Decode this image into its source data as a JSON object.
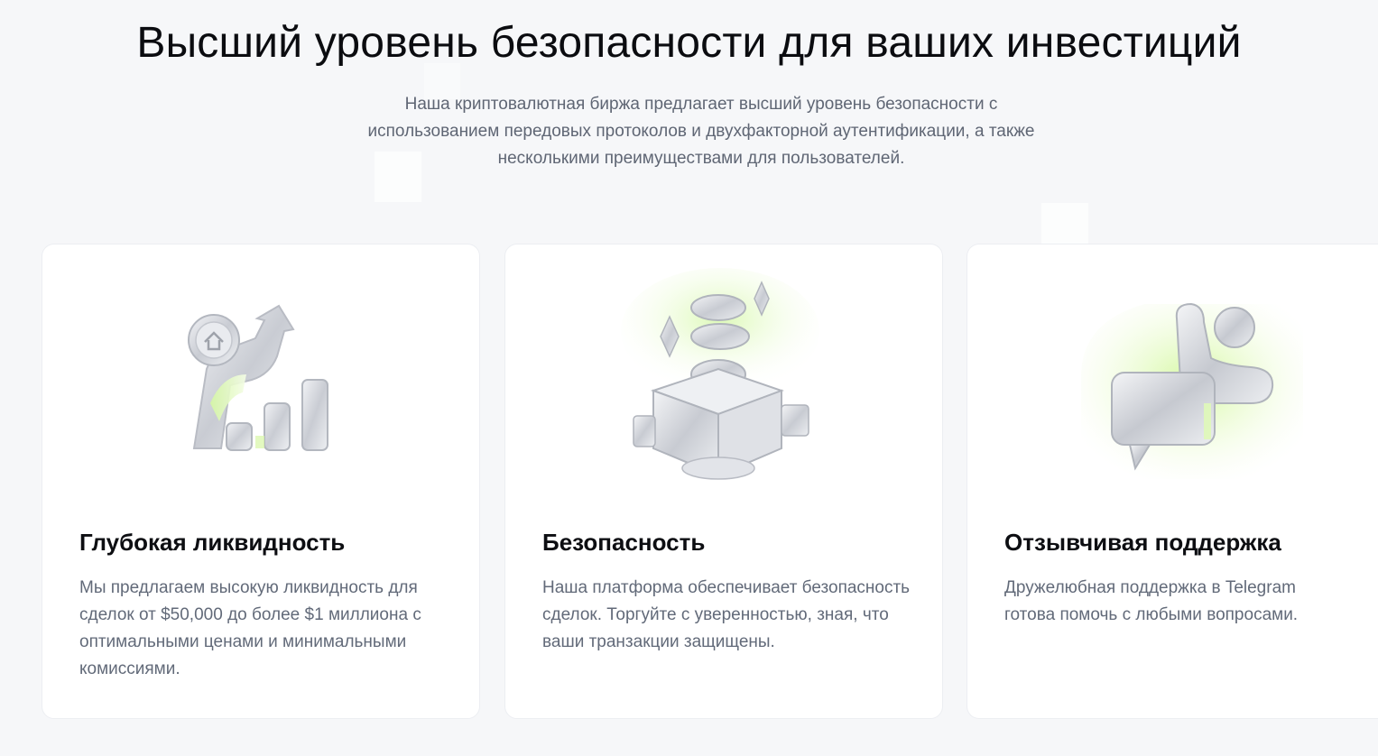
{
  "hero": {
    "title": "Высший уровень безопасности для ваших инвестиций",
    "subtitle": "Наша криптовалютная биржа предлагает высший уровень безопасности с использованием передовых протоколов и двухфакторной аутентификации, а также несколькими преимуществами для пользователей."
  },
  "features": [
    {
      "icon": "growth-chart-icon",
      "title": "Глубокая ликвидность",
      "text": "Мы предлагаем высокую ликвидность для сделок от $50,000 до более $1 миллиона с оптимальными ценами и минимальными комиссиями."
    },
    {
      "icon": "secure-box-icon",
      "title": "Безопасность",
      "text": "Наша платформа обеспечивает безопасность сделок. Торгуйте с уверенностью, зная, что ваши транзакции защищены."
    },
    {
      "icon": "support-chat-icon",
      "title": "Отзывчивая поддержка",
      "text": "Дружелюбная поддержка в Telegram готова помочь с любыми вопросами."
    }
  ],
  "colors": {
    "background": "#f6f7f9",
    "card": "#ffffff",
    "accent": "#b9f46a",
    "title": "#0b0c10",
    "muted": "#626a79"
  }
}
